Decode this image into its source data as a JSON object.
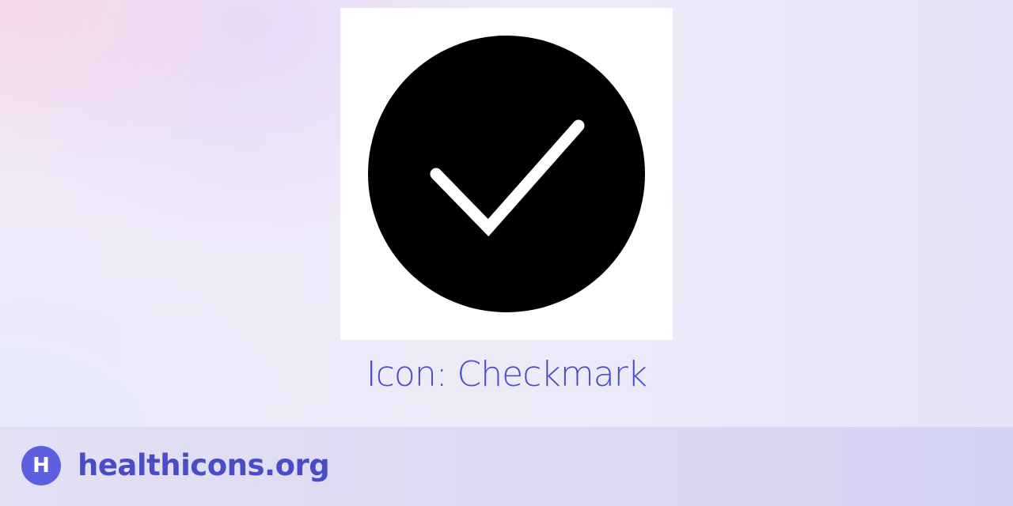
{
  "icon": {
    "name": "checkmark-icon",
    "title": "Icon: Checkmark",
    "fill_color": "#000000",
    "check_color": "#ffffff",
    "card_color": "#ffffff"
  },
  "footer": {
    "logo_letter": "H",
    "site_name": "healthicons.org",
    "logo_color": "#5d5fe0",
    "text_color": "#4a4cc4"
  }
}
